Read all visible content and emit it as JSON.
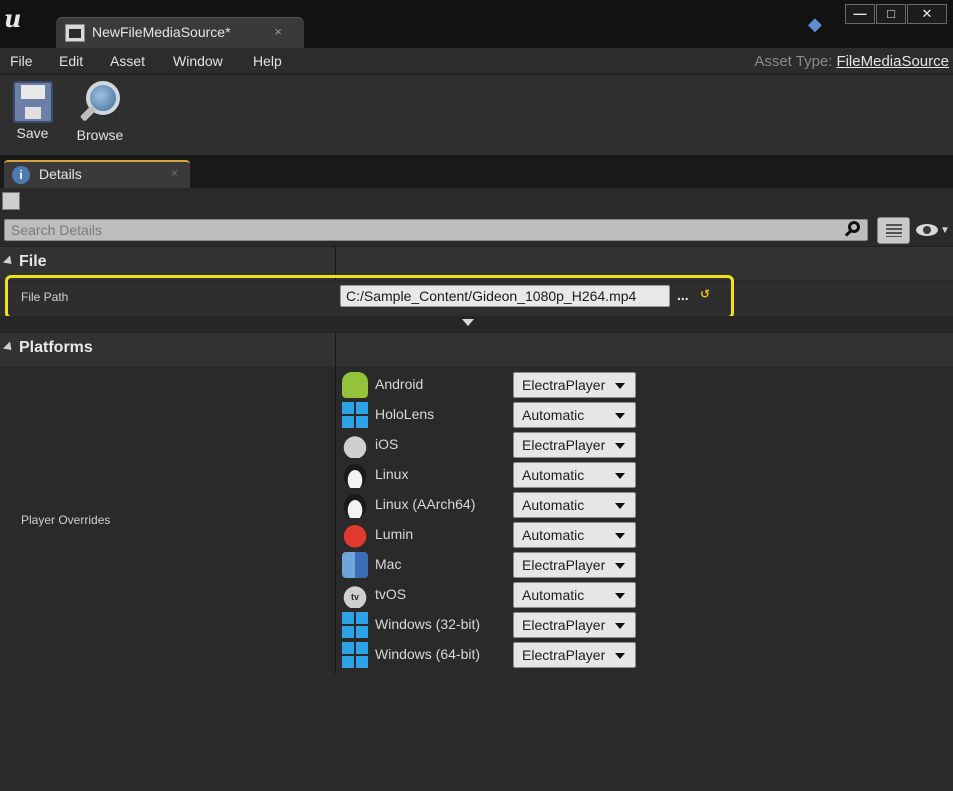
{
  "window": {
    "doc_tab_label": "NewFileMediaSource",
    "doc_tab_modified": "*",
    "doc_tab_close": "×",
    "minimize": "—",
    "maximize": "□",
    "close": "✕"
  },
  "menu": {
    "items": [
      "File",
      "Edit",
      "Asset",
      "Window",
      "Help"
    ],
    "asset_type_label": "Asset Type:",
    "asset_type_value": "FileMediaSource"
  },
  "toolbar": {
    "save_label": "Save",
    "browse_label": "Browse"
  },
  "details": {
    "tab_label": "Details",
    "tab_close": "×",
    "search_placeholder": "Search Details",
    "categories": {
      "file": "File",
      "platforms": "Platforms"
    },
    "file_path_label": "File Path",
    "file_path_value": "C:/Sample_Content/Gideon_1080p_H264.mp4",
    "browse_dots": "...",
    "player_overrides_label": "Player Overrides",
    "platforms": [
      {
        "name": "Android",
        "icon": "android-icon",
        "player": "ElectraPlayer"
      },
      {
        "name": "HoloLens",
        "icon": "windows-icon",
        "player": "Automatic"
      },
      {
        "name": "iOS",
        "icon": "apple-icon",
        "player": "ElectraPlayer"
      },
      {
        "name": "Linux",
        "icon": "linux-icon",
        "player": "Automatic"
      },
      {
        "name": "Linux (AArch64)",
        "icon": "linux-icon",
        "player": "Automatic"
      },
      {
        "name": "Lumin",
        "icon": "lumin-icon",
        "player": "Automatic"
      },
      {
        "name": "Mac",
        "icon": "mac-icon",
        "player": "ElectraPlayer"
      },
      {
        "name": "tvOS",
        "icon": "tvos-icon",
        "player": "Automatic"
      },
      {
        "name": "Windows (32-bit)",
        "icon": "windows-icon",
        "player": "ElectraPlayer"
      },
      {
        "name": "Windows (64-bit)",
        "icon": "windows-icon",
        "player": "ElectraPlayer"
      }
    ]
  },
  "colors": {
    "highlight": "#f0e01e",
    "tab_accent": "#d9a23a"
  }
}
